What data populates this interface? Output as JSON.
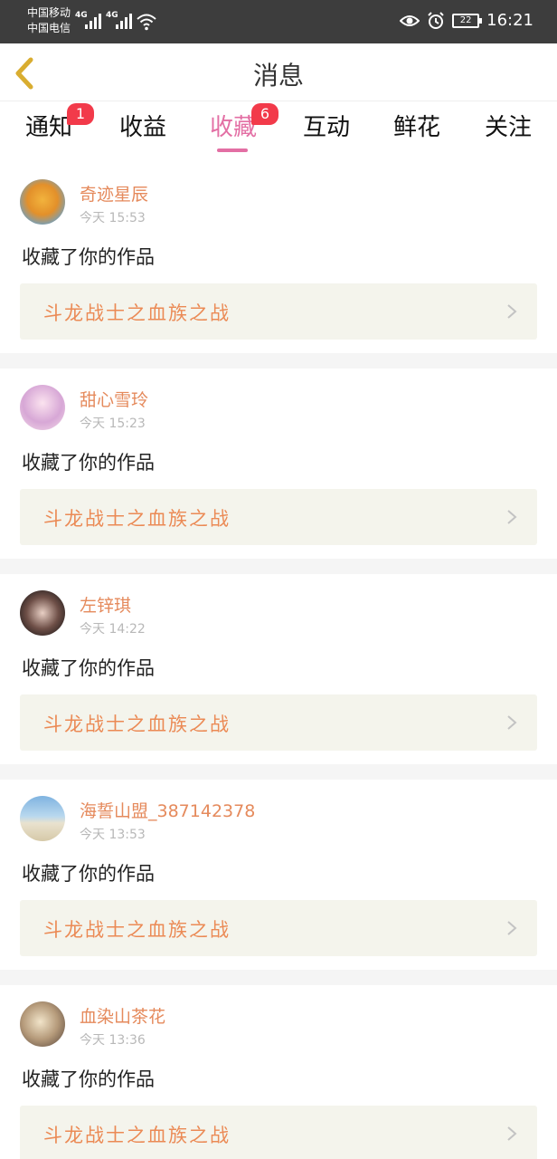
{
  "status_bar": {
    "carrier1": "中国移动",
    "carrier2": "中国电信",
    "net1": "4G",
    "net2": "4G",
    "battery": "22",
    "time": "16:21",
    "icons": [
      "eye-icon",
      "alarm-icon",
      "battery-icon",
      "wifi-icon",
      "signal-icon"
    ]
  },
  "nav": {
    "title": "消息",
    "back_icon": "chevron-left-icon"
  },
  "tabs": [
    {
      "label": "通知",
      "badge": "1"
    },
    {
      "label": "收益",
      "badge": null
    },
    {
      "label": "收藏",
      "badge": "6",
      "active": true
    },
    {
      "label": "互动",
      "badge": null
    },
    {
      "label": "鲜花",
      "badge": null
    },
    {
      "label": "关注",
      "badge": null
    }
  ],
  "notifications": [
    {
      "user": "奇迹星辰",
      "time": "今天 15:53",
      "action": "收藏了你的作品",
      "work": "斗龙战士之血族之战"
    },
    {
      "user": "甜心雪玲",
      "time": "今天 15:23",
      "action": "收藏了你的作品",
      "work": "斗龙战士之血族之战"
    },
    {
      "user": "左锌琪",
      "time": "今天 14:22",
      "action": "收藏了你的作品",
      "work": "斗龙战士之血族之战"
    },
    {
      "user": "海誓山盟_387142378",
      "time": "今天 13:53",
      "action": "收藏了你的作品",
      "work": "斗龙战士之血族之战"
    },
    {
      "user": "血染山茶花",
      "time": "今天 13:36",
      "action": "收藏了你的作品",
      "work": "斗龙战士之血族之战"
    }
  ],
  "colors": {
    "accent": "#e36fa4",
    "username": "#e58a5c",
    "work_title": "#eb8a55",
    "badge": "#f23a4a",
    "work_bg": "#f4f4ec",
    "status_bar_bg": "#3d3d3d"
  }
}
